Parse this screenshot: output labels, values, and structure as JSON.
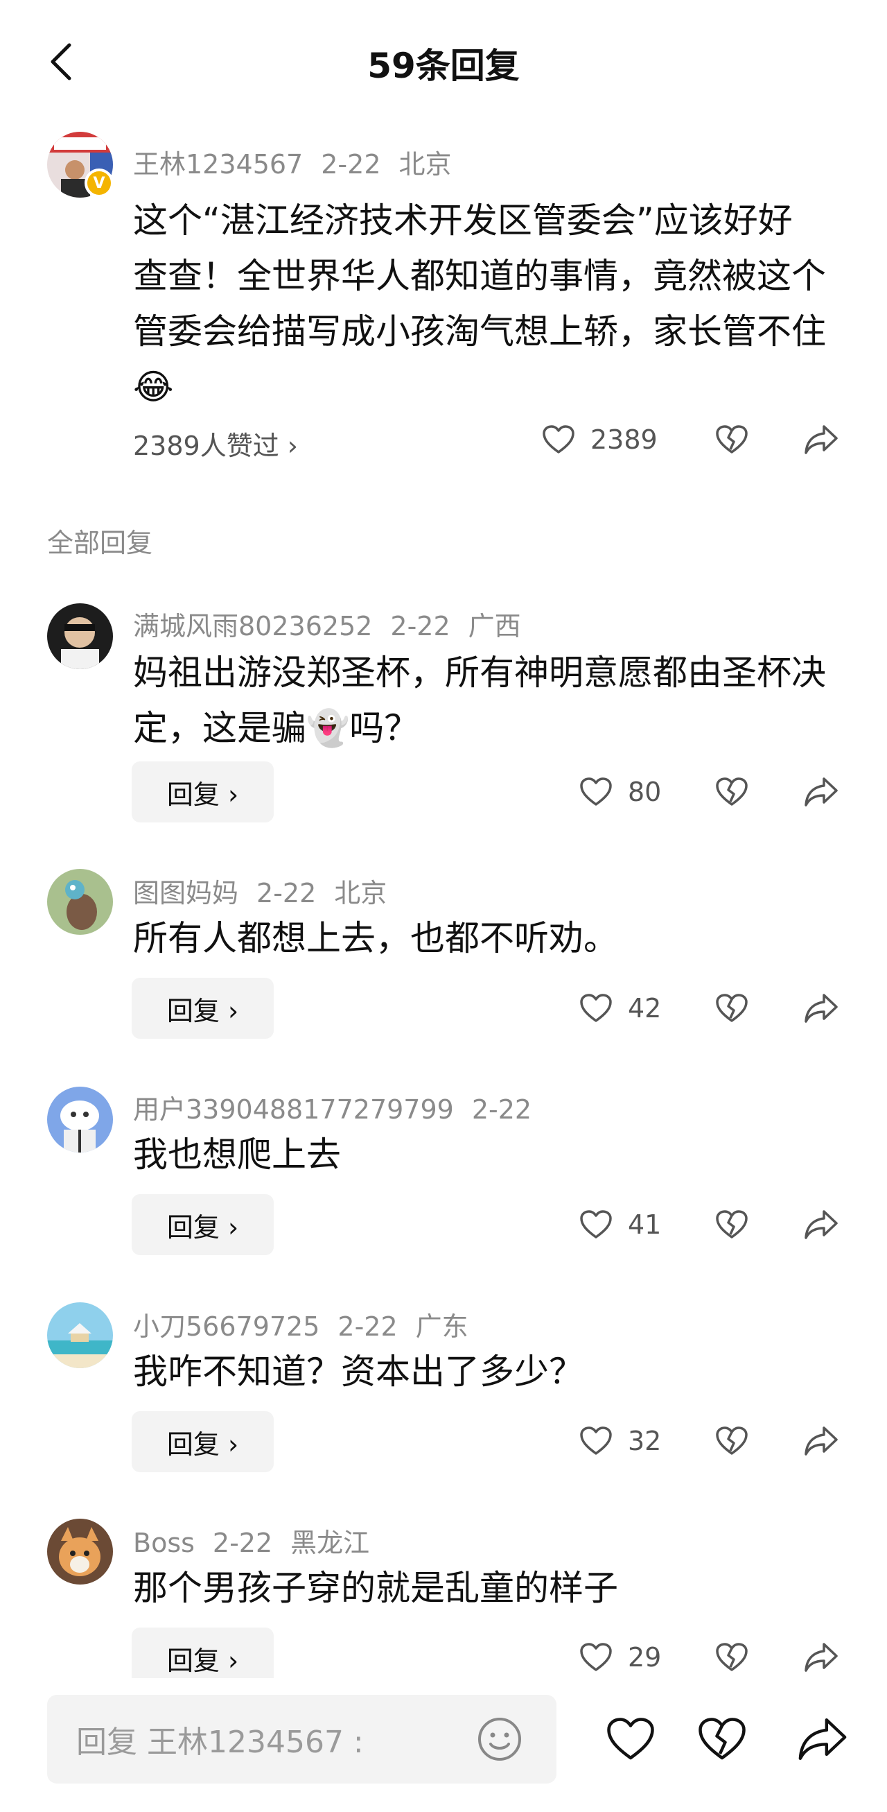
{
  "header": {
    "title": "59条回复"
  },
  "main_comment": {
    "username": "王林1234567",
    "date": "2-22",
    "location": "北京",
    "text": "这个“湛江经济技术开发区管委会”应该好好查查！全世界华人都知道的事情，竟然被这个管委会给描写成小孩淘气想上轿，家长管不住😂",
    "likes_link": "2389人赞过 ›",
    "like_count": "2389",
    "badge": "V"
  },
  "section_label": "全部回复",
  "replies": [
    {
      "username": "满城风雨80236252",
      "date": "2-22",
      "location": "广西",
      "text": "妈祖出游没郑圣杯，所有神明意愿都由圣杯决定，这是骗👻吗？",
      "reply_label": "回复 ›",
      "like_count": "80"
    },
    {
      "username": "图图妈妈",
      "date": "2-22",
      "location": "北京",
      "text": "所有人都想上去，也都不听劝。",
      "reply_label": "回复 ›",
      "like_count": "42"
    },
    {
      "username": "用户3390488177279799",
      "date": "2-22",
      "location": "",
      "text": "我也想爬上去",
      "reply_label": "回复 ›",
      "like_count": "41"
    },
    {
      "username": "小刀56679725",
      "date": "2-22",
      "location": "广东",
      "text": "我咋不知道？资本出了多少？",
      "reply_label": "回复 ›",
      "like_count": "32"
    },
    {
      "username": "Boss",
      "date": "2-22",
      "location": "黑龙江",
      "text": "那个男孩子穿的就是乱童的样子",
      "reply_label": "回复 ›",
      "like_count": "29"
    }
  ],
  "bottom_bar": {
    "placeholder": "回复 王林1234567 :"
  }
}
